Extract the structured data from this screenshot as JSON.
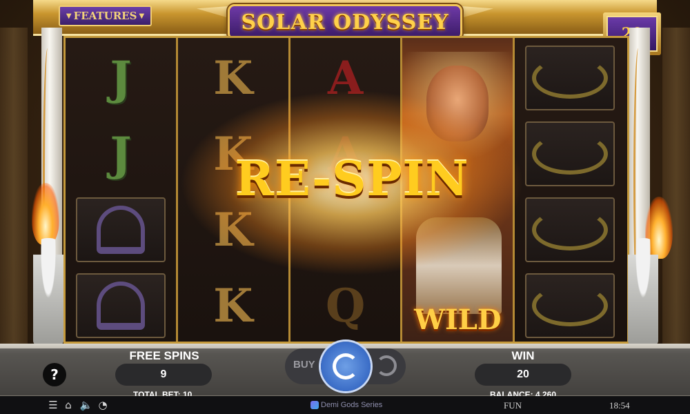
{
  "game": {
    "title": "SOLAR ODYSSEY",
    "features_label": "FEATURES",
    "lines_count": "20"
  },
  "reels": {
    "symbols": [
      [
        "J",
        "J",
        "harp",
        "harp"
      ],
      [
        "K",
        "K",
        "K",
        "K"
      ],
      [
        "A",
        "A",
        "",
        "Q"
      ],
      [
        "wild",
        "wild",
        "wild",
        "wild"
      ],
      [
        "laurel",
        "laurel",
        "laurel",
        "laurel"
      ]
    ],
    "wild_label": "WILD"
  },
  "banner": {
    "text": "RE-SPIN"
  },
  "hud": {
    "free_spins_label": "FREE SPINS",
    "free_spins_value": "9",
    "win_label": "WIN",
    "win_value": "20",
    "total_bet": "TOTAL BET: 10",
    "balance": "BALANCE: 4,260",
    "buy_label": "BUY"
  },
  "footer": {
    "series": "Demi Gods Series",
    "mode": "FUN",
    "time": "18:54"
  },
  "icons": {
    "menu": "menu-icon",
    "home": "home-icon",
    "sound": "sound-icon",
    "turbo": "turbo-icon",
    "help": "help-icon"
  },
  "colors": {
    "gold": "#ffcc1f",
    "purple": "#4a2688",
    "spin_blue": "#3a6cc6"
  }
}
